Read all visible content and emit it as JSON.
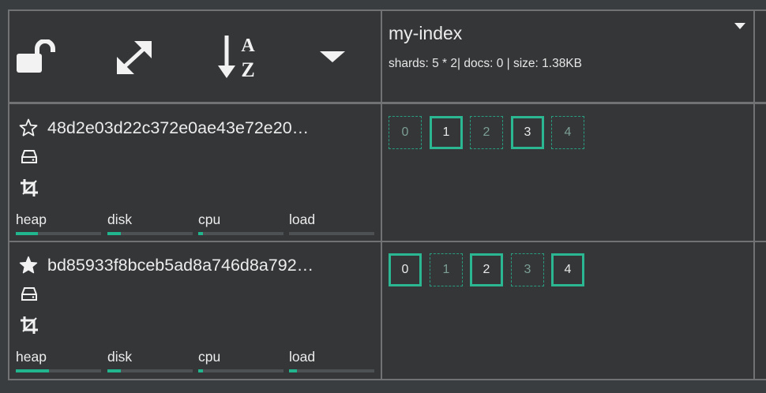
{
  "header": {
    "controls": [
      {
        "name": "unlock-icon",
        "label": "lock"
      },
      {
        "name": "expand-icon",
        "label": "expand"
      },
      {
        "name": "sort-az-icon",
        "label": "sort"
      },
      {
        "name": "caret-down-icon",
        "label": "menu"
      }
    ]
  },
  "index": {
    "name": "my-index",
    "stats": "shards: 5 * 2| docs: 0 | size: 1.38KB"
  },
  "nodes": [
    {
      "name": "48d2e03d22c372e0ae43e72e20…",
      "is_master": false,
      "metrics": [
        {
          "label": "heap",
          "value": 0.26
        },
        {
          "label": "disk",
          "value": 0.16
        },
        {
          "label": "cpu",
          "value": 0.06
        },
        {
          "label": "load",
          "value": 0.0
        }
      ],
      "shards": [
        {
          "label": "0",
          "primary": false
        },
        {
          "label": "1",
          "primary": true
        },
        {
          "label": "2",
          "primary": false
        },
        {
          "label": "3",
          "primary": true
        },
        {
          "label": "4",
          "primary": false
        }
      ]
    },
    {
      "name": "bd85933f8bceb5ad8a746d8a792…",
      "is_master": true,
      "metrics": [
        {
          "label": "heap",
          "value": 0.39
        },
        {
          "label": "disk",
          "value": 0.16
        },
        {
          "label": "cpu",
          "value": 0.06
        },
        {
          "label": "load",
          "value": 0.09
        }
      ],
      "shards": [
        {
          "label": "0",
          "primary": true
        },
        {
          "label": "1",
          "primary": false
        },
        {
          "label": "2",
          "primary": true
        },
        {
          "label": "3",
          "primary": false
        },
        {
          "label": "4",
          "primary": true
        }
      ]
    }
  ],
  "colors": {
    "background": "#343638",
    "grid_line": "#707273",
    "accent": "#22b68e",
    "bar_track": "#4d5153"
  }
}
